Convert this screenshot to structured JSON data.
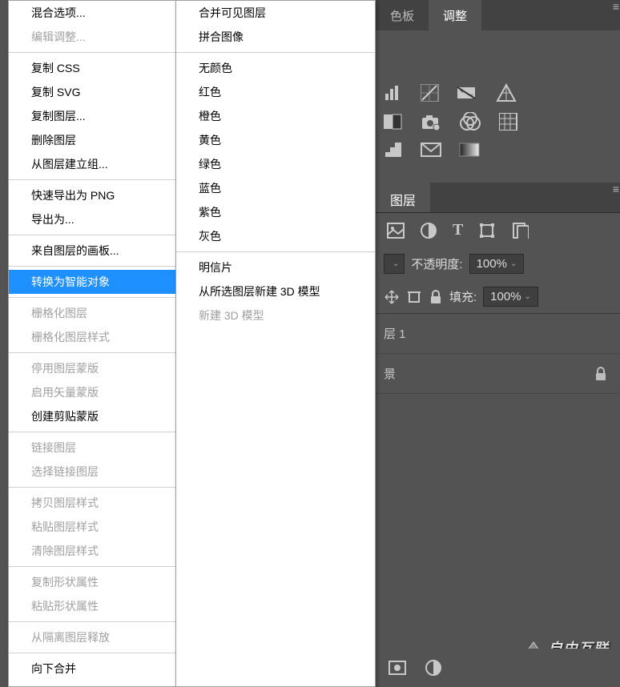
{
  "menu_left": {
    "blend_options": "混合选项...",
    "edit_adjust": "编辑调整...",
    "copy_css": "复制 CSS",
    "copy_svg": "复制 SVG",
    "duplicate_layer": "复制图层...",
    "delete_layer": "删除图层",
    "group_from_layers": "从图层建立组...",
    "quick_export_png": "快速导出为 PNG",
    "export_as": "导出为...",
    "artboard_from_layers": "来自图层的画板...",
    "convert_smart": "转换为智能对象",
    "rasterize_layer": "栅格化图层",
    "rasterize_style": "栅格化图层样式",
    "disable_layer_mask": "停用图层蒙版",
    "enable_vector_mask": "启用矢量蒙版",
    "create_clipping_mask": "创建剪贴蒙版",
    "link_layers": "链接图层",
    "select_linked": "选择链接图层",
    "copy_layer_style": "拷贝图层样式",
    "paste_layer_style": "粘贴图层样式",
    "clear_layer_style": "清除图层样式",
    "copy_shape_attrs": "复制形状属性",
    "paste_shape_attrs": "粘贴形状属性",
    "release_isolation": "从隔离图层释放",
    "merge_down": "向下合并"
  },
  "menu_right": {
    "merge_visible": "合并可见图层",
    "flatten": "拼合图像",
    "no_color": "无颜色",
    "red": "红色",
    "orange": "橙色",
    "yellow": "黄色",
    "green": "绿色",
    "blue": "蓝色",
    "purple": "紫色",
    "gray": "灰色",
    "postcard": "明信片",
    "new_3d_from_selection": "从所选图层新建 3D 模型",
    "new_3d": "新建 3D 模型"
  },
  "panel": {
    "tab_swatches": "色板",
    "tab_adjustments": "调整",
    "tab_layers": "图层",
    "opacity_label": "不透明度:",
    "opacity_value": "100%",
    "fill_label": "填充:",
    "fill_value": "100%",
    "layer1": "层 1",
    "background": "景"
  },
  "watermark": "自由互联"
}
